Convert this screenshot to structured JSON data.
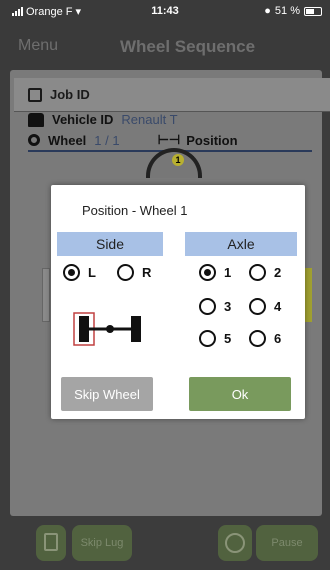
{
  "status_bar": {
    "carrier": "Orange F",
    "time": "11:43",
    "battery": "51 %"
  },
  "header": {
    "menu_label": "Menu",
    "title": "Wheel Sequence"
  },
  "job": {
    "label": "Job ID"
  },
  "vehicle": {
    "label": "Vehicle ID",
    "model": "Renault T"
  },
  "wheel": {
    "label": "Wheel",
    "count": "1 / 1",
    "position_label": "Position",
    "tire_number": "1"
  },
  "modal": {
    "title": "Position - Wheel 1",
    "side": {
      "header": "Side",
      "options": [
        "L",
        "R"
      ],
      "selected": "L"
    },
    "axle": {
      "header": "Axle",
      "options": [
        "1",
        "2",
        "3",
        "4",
        "5",
        "6"
      ],
      "selected": "1"
    },
    "skip_label": "Skip Wheel",
    "ok_label": "Ok"
  },
  "toolbar": {
    "skip_lug_label": "Skip Lug",
    "pause_label": "Pause"
  },
  "colors": {
    "header_blue": "#a8c1e6",
    "ok_green": "#799a5d",
    "skip_gray": "#a5a5a5",
    "axle_red": "#c04040"
  }
}
